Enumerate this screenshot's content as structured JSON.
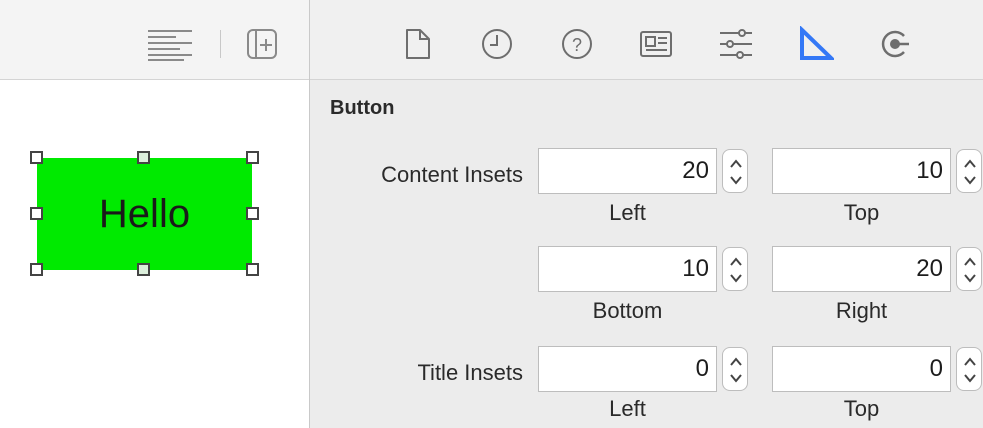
{
  "left_toolbar": {
    "icons": [
      "align-lines-icon",
      "add-editor-icon"
    ]
  },
  "canvas": {
    "button_label": "Hello",
    "button_color": "#00ea00"
  },
  "inspector_tabs": [
    {
      "name": "file-inspector-icon",
      "active": false
    },
    {
      "name": "history-inspector-icon",
      "active": false
    },
    {
      "name": "quick-help-icon",
      "active": false
    },
    {
      "name": "identity-inspector-icon",
      "active": false
    },
    {
      "name": "attributes-inspector-icon",
      "active": false
    },
    {
      "name": "size-inspector-icon",
      "active": true
    },
    {
      "name": "connections-inspector-icon",
      "active": false
    }
  ],
  "accent_color": "#3478f6",
  "section": {
    "title": "Button",
    "content_insets": {
      "label": "Content Insets",
      "left": "20",
      "top": "10",
      "bottom": "10",
      "right": "20",
      "left_label": "Left",
      "top_label": "Top",
      "bottom_label": "Bottom",
      "right_label": "Right"
    },
    "title_insets": {
      "label": "Title Insets",
      "left": "0",
      "top": "0",
      "left_label": "Left",
      "top_label": "Top"
    }
  }
}
